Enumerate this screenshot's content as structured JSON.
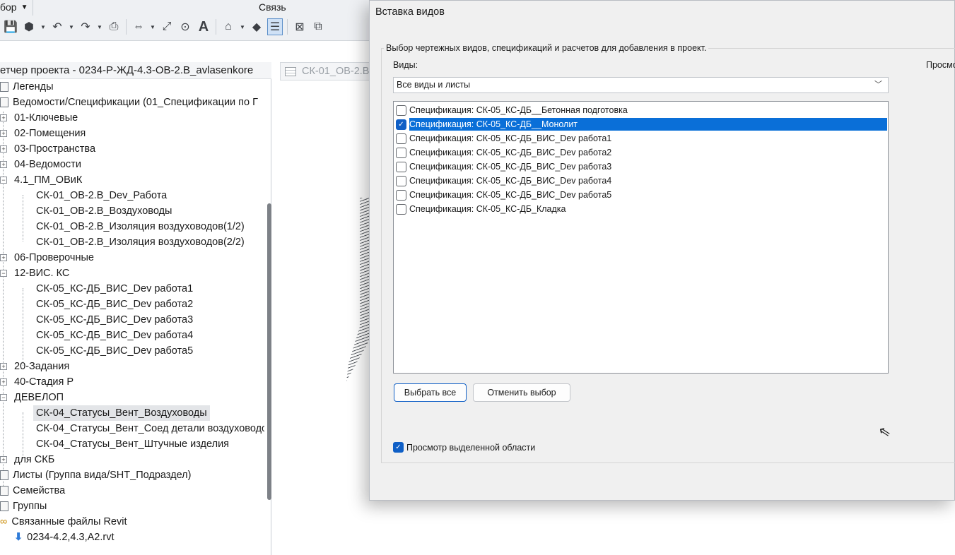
{
  "ribbon": {
    "left_label": "бор",
    "right_label": "Связь"
  },
  "browser": {
    "title": "етчер проекта - 0234-Р-ЖД-4.3-ОВ-2.В_avlasenkore",
    "items": [
      {
        "label": "Легенды"
      },
      {
        "label": "Ведомости/Спецификации (01_Спецификации по Г"
      },
      {
        "label": "01-Ключевые"
      },
      {
        "label": "02-Помещения"
      },
      {
        "label": "03-Пространства"
      },
      {
        "label": "04-Ведомости"
      },
      {
        "label": "4.1_ПМ_ОВиК"
      },
      {
        "label": "СК-01_ОВ-2.В_Dev_Работа"
      },
      {
        "label": "СК-01_ОВ-2.В_Воздуховоды"
      },
      {
        "label": "СК-01_ОВ-2.В_Изоляция воздуховодов(1/2)"
      },
      {
        "label": "СК-01_ОВ-2.В_Изоляция воздуховодов(2/2)"
      },
      {
        "label": "06-Проверочные"
      },
      {
        "label": "12-ВИС. КС"
      },
      {
        "label": "СК-05_КС-ДБ_ВИС_Dev работа1"
      },
      {
        "label": "СК-05_КС-ДБ_ВИС_Dev работа2"
      },
      {
        "label": "СК-05_КС-ДБ_ВИС_Dev работа3"
      },
      {
        "label": "СК-05_КС-ДБ_ВИС_Dev работа4"
      },
      {
        "label": "СК-05_КС-ДБ_ВИС_Dev работа5"
      },
      {
        "label": "20-Задания"
      },
      {
        "label": "40-Стадия Р"
      },
      {
        "label": "ДЕВЕЛОП"
      },
      {
        "label": "СК-04_Статусы_Вент_Воздуховоды"
      },
      {
        "label": "СК-04_Статусы_Вент_Соед детали воздуховодо"
      },
      {
        "label": "СК-04_Статусы_Вент_Штучные изделия"
      },
      {
        "label": "для СКБ"
      },
      {
        "label": "Листы (Группа вида/SHT_Подраздел)"
      },
      {
        "label": "Семейства"
      },
      {
        "label": "Группы"
      },
      {
        "label": "Связанные файлы Revit"
      },
      {
        "label": "0234-4.2,4.3,А2.rvt"
      }
    ]
  },
  "view_tab": {
    "label": "СК-01_ОВ-2.В"
  },
  "dialog": {
    "title": "Вставка видов",
    "group_caption": "Выбор чертежных видов, спецификаций и расчетов для добавления в проект.",
    "views_label": "Виды:",
    "preview_label": "Просмо",
    "dropdown_value": "Все виды и листы",
    "list": [
      {
        "label": "Спецификация: СК-05_КС-ДБ__Бетонная подготовка",
        "checked": false
      },
      {
        "label": "Спецификация: СК-05_КС-ДБ__Монолит",
        "checked": true
      },
      {
        "label": "Спецификация: СК-05_КС-ДБ_ВИС_Dev работа1",
        "checked": false
      },
      {
        "label": "Спецификация: СК-05_КС-ДБ_ВИС_Dev работа2",
        "checked": false
      },
      {
        "label": "Спецификация: СК-05_КС-ДБ_ВИС_Dev работа3",
        "checked": false
      },
      {
        "label": "Спецификация: СК-05_КС-ДБ_ВИС_Dev работа4",
        "checked": false
      },
      {
        "label": "Спецификация: СК-05_КС-ДБ_ВИС_Dev работа5",
        "checked": false
      },
      {
        "label": "Спецификация: СК-05_КС-ДБ_Кладка",
        "checked": false
      }
    ],
    "select_all_label": "Выбрать все",
    "deselect_label": "Отменить выбор",
    "preview_check_label": "Просмотр выделенной области",
    "preview_checked": true
  },
  "colors": {
    "accent": "#0f5fc6",
    "selection": "#0a6fd8"
  }
}
